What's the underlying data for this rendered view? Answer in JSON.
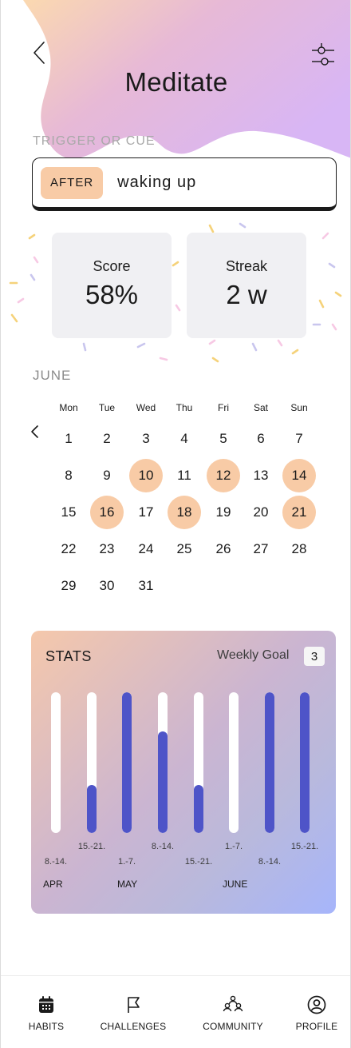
{
  "header": {
    "title": "Meditate"
  },
  "cue": {
    "label": "TRIGGER OR CUE",
    "chip": "AFTER",
    "text": "waking up"
  },
  "stat_cards": [
    {
      "label": "Score",
      "value": "58%"
    },
    {
      "label": "Streak",
      "value": "2 w"
    }
  ],
  "calendar": {
    "month": "JUNE",
    "weekdays": [
      "Mon",
      "Tue",
      "Wed",
      "Thu",
      "Fri",
      "Sat",
      "Sun"
    ],
    "days": [
      "1",
      "2",
      "3",
      "4",
      "5",
      "6",
      "7",
      "8",
      "9",
      "10",
      "11",
      "12",
      "13",
      "14",
      "15",
      "16",
      "17",
      "18",
      "19",
      "20",
      "21",
      "22",
      "23",
      "24",
      "25",
      "26",
      "27",
      "28",
      "29",
      "30",
      "31"
    ],
    "highlighted": [
      "10",
      "12",
      "14",
      "16",
      "18",
      "21"
    ]
  },
  "stats": {
    "title": "STATS",
    "weekly_goal_label": "Weekly Goal",
    "weekly_goal_value": "3",
    "weeks": [
      {
        "label": "8.-14.",
        "fraction": 0
      },
      {
        "label": "15.-21.",
        "fraction": 0.34
      },
      {
        "label": "1.-7.",
        "fraction": 1
      },
      {
        "label": "8.-14.",
        "fraction": 0.72
      },
      {
        "label": "15.-21.",
        "fraction": 0.34
      },
      {
        "label": "1.-7.",
        "fraction": 0
      },
      {
        "label": "8.-14.",
        "fraction": 1
      },
      {
        "label": "15.-21.",
        "fraction": 1
      }
    ],
    "months": [
      "APR",
      "MAY",
      "JUNE"
    ]
  },
  "colors": {
    "accent_peach": "#f8cba6",
    "bar_fill": "#4e54c8",
    "card_bg": "#f0f0f3"
  },
  "nav": [
    {
      "label": "HABITS",
      "icon": "calendar-icon"
    },
    {
      "label": "CHALLENGES",
      "icon": "flag-icon"
    },
    {
      "label": "COMMUNITY",
      "icon": "community-icon"
    },
    {
      "label": "PROFILE",
      "icon": "profile-icon"
    }
  ]
}
